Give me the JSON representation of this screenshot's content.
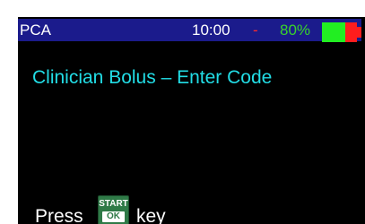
{
  "status_bar": {
    "mode": "PCA",
    "time": "10:00",
    "separator": "-",
    "battery_percent": "80%",
    "battery_level": 0.8,
    "colors": {
      "bar_bg": "#1b1b8c",
      "percent": "#39d32b",
      "separator": "#ff2a2a",
      "battery_green": "#22ee22",
      "battery_red": "#ff1d1d"
    }
  },
  "screen": {
    "title": "Clinician Bolus – Enter Code",
    "prompt_before": "Press",
    "prompt_after": "key",
    "title_color": "#22dde6",
    "background": "#000000"
  },
  "start_key": {
    "icon": "start-ok-key-icon",
    "label_top": "START",
    "label_bottom": "OK",
    "color": "#2f7a47"
  }
}
